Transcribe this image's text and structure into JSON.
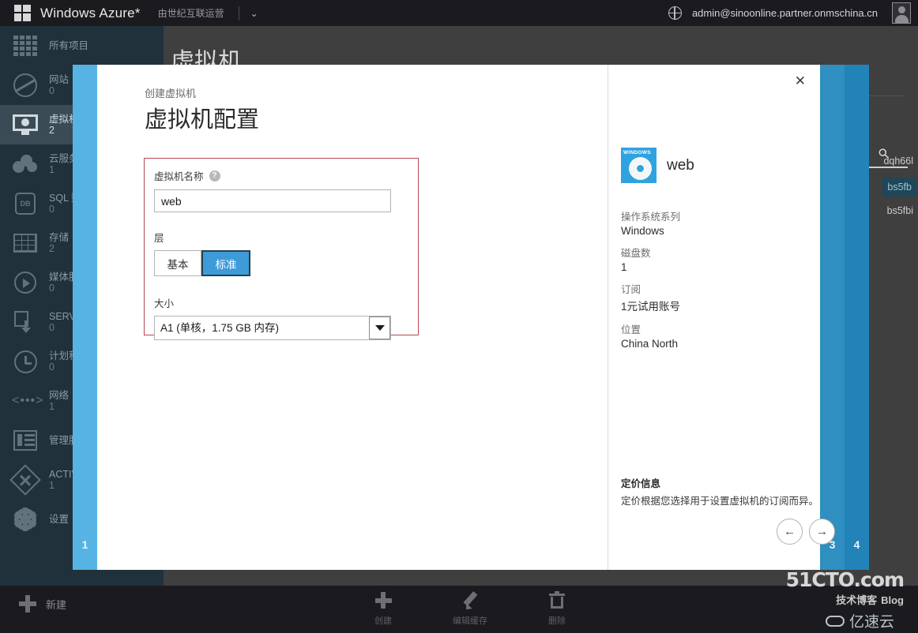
{
  "topbar": {
    "brand": "Windows Azure*",
    "tenant": "由世纪互联运营",
    "chevron": "⌄",
    "account": "admin@sinoonline.partner.onmschina.cn"
  },
  "sidebar": {
    "items": [
      {
        "label": "所有项目",
        "count": "",
        "icon": "grid-icon",
        "active": false
      },
      {
        "label": "网站",
        "count": "0",
        "icon": "globe-icon",
        "active": false
      },
      {
        "label": "虚拟机",
        "count": "2",
        "icon": "monitor-icon",
        "active": true
      },
      {
        "label": "云服务",
        "count": "1",
        "icon": "cloud-icon",
        "active": false
      },
      {
        "label": "SQL 数据库",
        "count": "0",
        "icon": "database-icon",
        "active": false
      },
      {
        "label": "存储",
        "count": "2",
        "icon": "table-icon",
        "active": false
      },
      {
        "label": "媒体服务",
        "count": "0",
        "icon": "media-icon",
        "active": false
      },
      {
        "label": "SERVICE BUS",
        "count": "0",
        "icon": "service-bus-icon",
        "active": false
      },
      {
        "label": "计划程序",
        "count": "0",
        "icon": "clock-icon",
        "active": false
      },
      {
        "label": "网络",
        "count": "1",
        "icon": "network-icon",
        "active": false
      },
      {
        "label": "管理服务",
        "count": "",
        "icon": "server-icon",
        "active": false
      },
      {
        "label": "ACTIVE DIRECTORY",
        "count": "1",
        "icon": "active-directory-icon",
        "active": false
      },
      {
        "label": "设置",
        "count": "",
        "icon": "gear-icon",
        "active": false
      }
    ]
  },
  "page": {
    "title": "虚拟机",
    "search_icon": "search-icon",
    "list": [
      {
        "name": "dqh66l",
        "selected": false
      },
      {
        "name": "bs5fb",
        "selected": true
      },
      {
        "name": "bs5fbi",
        "selected": false
      }
    ]
  },
  "modal": {
    "close_label": "✕",
    "breadcrumb": "创建虚拟机",
    "title": "虚拟机配置",
    "bands": {
      "left": "1",
      "right_a": "3",
      "right_b": "4"
    },
    "form": {
      "name_label": "虚拟机名称",
      "help_glyph": "?",
      "name_value": "web",
      "name_placeholder": "",
      "tier_label": "层",
      "tier_options": [
        "基本",
        "标准"
      ],
      "tier_selected": "标准",
      "size_label": "大小",
      "size_selected": "A1 (单核，1.75 GB 内存)",
      "size_options": [
        "A1 (单核，1.75 GB 内存)"
      ]
    },
    "info": {
      "vm_name": "web",
      "badge_text": "WINDOWS",
      "rows": [
        {
          "key": "操作系统系列",
          "value": "Windows"
        },
        {
          "key": "磁盘数",
          "value": "1"
        },
        {
          "key": "订阅",
          "value": "1元试用账号"
        },
        {
          "key": "位置",
          "value": "China North"
        }
      ]
    },
    "pricing": {
      "heading": "定价信息",
      "body": "定价根据您选择用于设置虚拟机的订阅而异。"
    },
    "nav": {
      "prev": "←",
      "next": "→"
    }
  },
  "bottombar": {
    "new_label": "新建",
    "actions": [
      {
        "label": "创建",
        "icon": "plus-icon"
      },
      {
        "label": "编辑缓存",
        "icon": "pencil-icon"
      },
      {
        "label": "删除",
        "icon": "trash-icon"
      }
    ]
  },
  "watermark": {
    "line1": "51CTO.com",
    "line2": "技术博客",
    "line2_suffix": "Blog",
    "line3": "亿速云"
  },
  "colors": {
    "accent_blue": "#3e9bd8",
    "band_light": "#56b3e3",
    "nav_bg": "#20313b",
    "error_border": "#b5484d"
  }
}
